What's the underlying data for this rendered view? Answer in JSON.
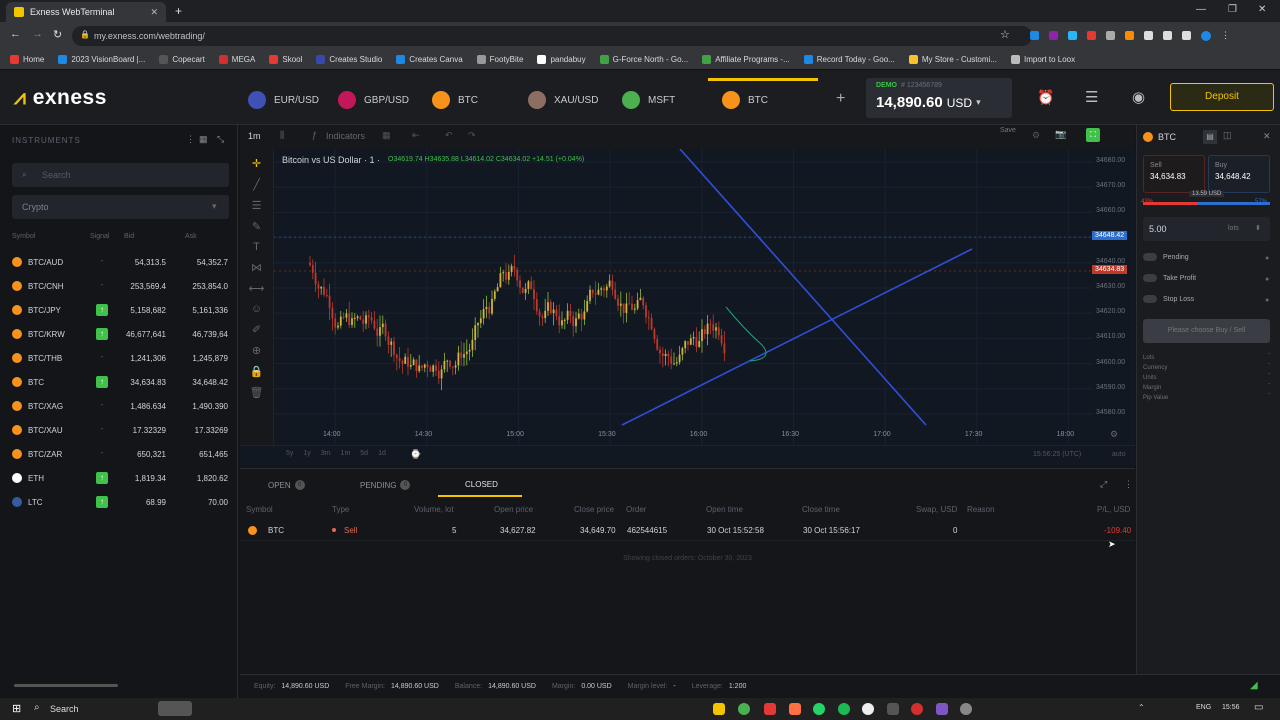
{
  "browser": {
    "tab_title": "Exness WebTerminal",
    "url": "my.exness.com/webtrading/",
    "bookmarks": [
      {
        "label": "Home",
        "color": "#e53935"
      },
      {
        "label": "2023 VisionBoard |...",
        "color": "#1e88e5"
      },
      {
        "label": "Copecart",
        "color": "#555"
      },
      {
        "label": "MEGA",
        "color": "#d32f2f"
      },
      {
        "label": "Skool",
        "color": "#e53935"
      },
      {
        "label": "Creates Studio",
        "color": "#3949ab"
      },
      {
        "label": "Creates Canva",
        "color": "#1e88e5"
      },
      {
        "label": "FootyBite",
        "color": "#999"
      },
      {
        "label": "pandabuy",
        "color": "#fff"
      },
      {
        "label": "G-Force North - Go...",
        "color": "#43a047"
      },
      {
        "label": "Affiliate Programs -...",
        "color": "#43a047"
      },
      {
        "label": "Record Today - Goo...",
        "color": "#1e88e5"
      },
      {
        "label": "My Store - Customi...",
        "color": "#fbc02d"
      },
      {
        "label": "Import to Loox",
        "color": "#bbb"
      }
    ]
  },
  "header": {
    "logo": "exness",
    "tabs": [
      {
        "label": "EUR/USD",
        "color": "#3f51b5"
      },
      {
        "label": "GBP/USD",
        "color": "#c2185b"
      },
      {
        "label": "BTC",
        "color": "#f7931a"
      },
      {
        "label": "XAU/USD",
        "color": "#8d6e63"
      },
      {
        "label": "MSFT",
        "color": "#4caf50"
      },
      {
        "label": "BTC",
        "color": "#f7931a"
      }
    ],
    "account_mode": "DEMO",
    "account_id": "# 123456789",
    "balance": "14,890.60",
    "currency": "USD",
    "deposit_label": "Deposit"
  },
  "instruments": {
    "title": "INSTRUMENTS",
    "search_placeholder": "Search",
    "filter": "Crypto",
    "columns": [
      "Symbol",
      "Signal",
      "Bid",
      "Ask"
    ],
    "rows": [
      {
        "symbol": "BTC/AUD",
        "signal": "-",
        "bid": "54,313.5",
        "ask": "54,352.7",
        "color": "#f7931a",
        "sig": false
      },
      {
        "symbol": "BTC/CNH",
        "signal": "-",
        "bid": "253,569.4",
        "ask": "253,854.0",
        "color": "#f7931a",
        "sig": false
      },
      {
        "symbol": "BTC/JPY",
        "signal": "↑",
        "bid": "5,158,682",
        "ask": "5,161,336",
        "color": "#f7931a",
        "sig": true
      },
      {
        "symbol": "BTC/KRW",
        "signal": "↑",
        "bid": "46,677,641",
        "ask": "46,739,64",
        "color": "#f7931a",
        "sig": true
      },
      {
        "symbol": "BTC/THB",
        "signal": "-",
        "bid": "1,241,306",
        "ask": "1,245,879",
        "color": "#f7931a",
        "sig": false
      },
      {
        "symbol": "BTC",
        "signal": "↑",
        "bid": "34,634.83",
        "ask": "34,648.42",
        "color": "#f7931a",
        "sig": true
      },
      {
        "symbol": "BTC/XAG",
        "signal": "-",
        "bid": "1,486.634",
        "ask": "1,490.390",
        "color": "#f7931a",
        "sig": false
      },
      {
        "symbol": "BTC/XAU",
        "signal": "-",
        "bid": "17.32329",
        "ask": "17.33269",
        "color": "#f7931a",
        "sig": false
      },
      {
        "symbol": "BTC/ZAR",
        "signal": "-",
        "bid": "650,321",
        "ask": "651,465",
        "color": "#f7931a",
        "sig": false
      },
      {
        "symbol": "ETH",
        "signal": "↑",
        "bid": "1,819.34",
        "ask": "1,820.62",
        "color": "#ffffff",
        "sig": true
      },
      {
        "symbol": "LTC",
        "signal": "↑",
        "bid": "68.99",
        "ask": "70.00",
        "color": "#345d9d",
        "sig": true
      }
    ]
  },
  "chart": {
    "timeframe": "1m",
    "indicators": "Indicators",
    "title": "Bitcoin vs US Dollar · 1 ·",
    "ohlc": "O34619.74 H34635.88 L34614.02 C34634.02 +14.51 (+0.04%)",
    "save": "Save",
    "price_ticks": [
      "34680.00",
      "34670.00",
      "34660.00",
      "34650.00",
      "34640.00",
      "34630.00",
      "34620.00",
      "34610.00",
      "34600.00",
      "34590.00",
      "34580.00"
    ],
    "time_ticks": [
      "14:00",
      "14:30",
      "15:00",
      "15:30",
      "16:00",
      "16:30",
      "17:00",
      "17:30",
      "18:00"
    ],
    "ask_tag": "34648.42",
    "bid_tag": "34634.83",
    "ranges": [
      "5y",
      "1y",
      "3m",
      "1m",
      "5d",
      "1d"
    ],
    "clock": "15:56:25 (UTC)",
    "auto": "auto"
  },
  "order": {
    "symbol": "BTC",
    "sell_label": "Sell",
    "sell_price": "34,634.83",
    "buy_label": "Buy",
    "buy_price": "34,648.42",
    "spread": "13.59 USD",
    "sell_pct": "43%",
    "buy_pct": "57%",
    "volume": "5.00",
    "volume_unit": "lots",
    "pending": "Pending",
    "take_profit": "Take Profit",
    "stop_loss": "Stop Loss",
    "confirm": "Please choose Buy / Sell",
    "info": [
      "Lots",
      "Currency",
      "Units",
      "Margin",
      "Pip Value"
    ]
  },
  "bottom": {
    "tabs": [
      {
        "label": "OPEN",
        "badge": "0"
      },
      {
        "label": "PENDING",
        "badge": "0"
      },
      {
        "label": "CLOSED",
        "badge": ""
      }
    ],
    "columns": [
      "Symbol",
      "Type",
      "Volume, lot",
      "Open price",
      "Close price",
      "Order",
      "Open time",
      "Close time",
      "Swap, USD",
      "Reason",
      "P/L, USD"
    ],
    "row": {
      "symbol": "BTC",
      "type": "Sell",
      "volume": "5",
      "open": "34,627.82",
      "close": "34,649.70",
      "order": "462544615",
      "open_time": "30 Oct 15:52:58",
      "close_time": "30 Oct 15:56:17",
      "swap": "0",
      "reason": "",
      "pl": "-109.40"
    },
    "note": "Showing closed orders: October 30, 2023"
  },
  "status": {
    "equity_label": "Equity:",
    "equity": "14,890.60 USD",
    "free_margin_label": "Free Margin:",
    "free_margin": "14,890.60 USD",
    "balance_label": "Balance:",
    "balance": "14,890.60 USD",
    "margin_label": "Margin:",
    "margin": "0.00 USD",
    "margin_level_label": "Margin level:",
    "margin_level": "-",
    "leverage_label": "Leverage:",
    "leverage": "1:200"
  },
  "taskbar": {
    "search": "Search",
    "lang": "ENG",
    "time": "15:56"
  }
}
